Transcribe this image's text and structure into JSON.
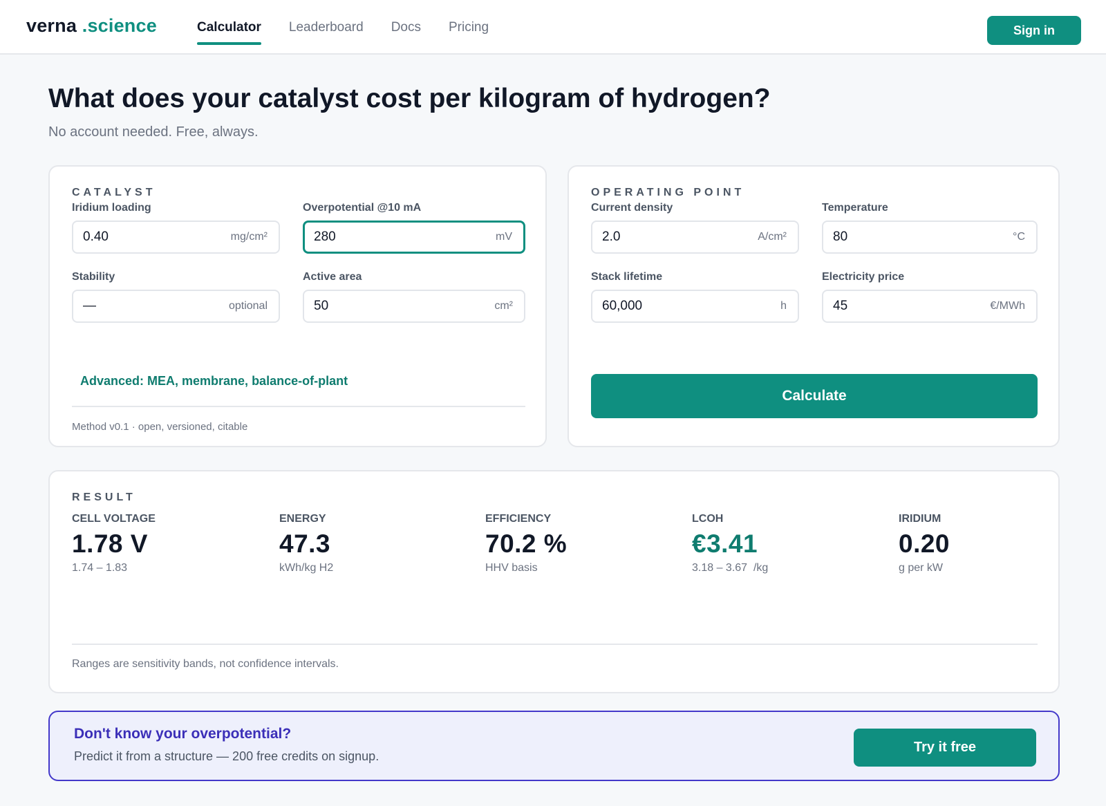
{
  "header": {
    "logo_main": "verna ",
    "logo_accent": ".science",
    "nav": [
      {
        "label": "Calculator"
      },
      {
        "label": "Leaderboard"
      },
      {
        "label": "Docs"
      },
      {
        "label": "Pricing"
      }
    ],
    "signin_label": "Sign in"
  },
  "page": {
    "title": "What does your catalyst cost per kilogram of hydrogen?",
    "subtitle": "No account needed. Free, always."
  },
  "catalyst": {
    "section_title": "CATALYST",
    "fields": [
      {
        "label": "Iridium loading",
        "value": "0.40",
        "unit": "mg/cm²"
      },
      {
        "label": "Overpotential @10 mA",
        "value": "280",
        "unit": "mV"
      },
      {
        "label": "Stability",
        "value": "—",
        "unit": "optional"
      },
      {
        "label": "Active area",
        "value": "50",
        "unit": "cm²"
      }
    ],
    "advanced_label": "Advanced: MEA, membrane, balance-of-plant",
    "method_note": "Method v0.1 · open, versioned, citable"
  },
  "operating": {
    "section_title": "OPERATING POINT",
    "fields": [
      {
        "label": "Current density",
        "value": "2.0",
        "unit": "A/cm²"
      },
      {
        "label": "Temperature",
        "value": "80",
        "unit": "°C"
      },
      {
        "label": "Stack lifetime",
        "value": "60,000",
        "unit": "h"
      },
      {
        "label": "Electricity price",
        "value": "45",
        "unit": "€/MWh"
      }
    ],
    "calculate_label": "Calculate"
  },
  "result": {
    "section_title": "RESULT",
    "metrics": [
      {
        "label": "CELL VOLTAGE",
        "value": "1.78 V",
        "sub": "1.74 – 1.83"
      },
      {
        "label": "ENERGY",
        "value": "47.3",
        "sub": "kWh/kg H2"
      },
      {
        "label": "EFFICIENCY",
        "value": "70.2 %",
        "sub": "HHV basis"
      },
      {
        "label": "LCOH",
        "value": "€3.41",
        "sub": "3.18 – 3.67  /kg"
      },
      {
        "label": "IRIDIUM",
        "value": "0.20",
        "sub": "g per kW"
      }
    ],
    "note": "Ranges are sensitivity bands, not confidence intervals."
  },
  "promo": {
    "title": "Don't know your overpotential?",
    "subtitle": "Predict it from a structure — 200 free credits on signup.",
    "button_label": "Try it free"
  },
  "colors": {
    "accent": "#0f8f80",
    "promo_border": "#4338ca",
    "promo_title": "#3b2fb8"
  }
}
